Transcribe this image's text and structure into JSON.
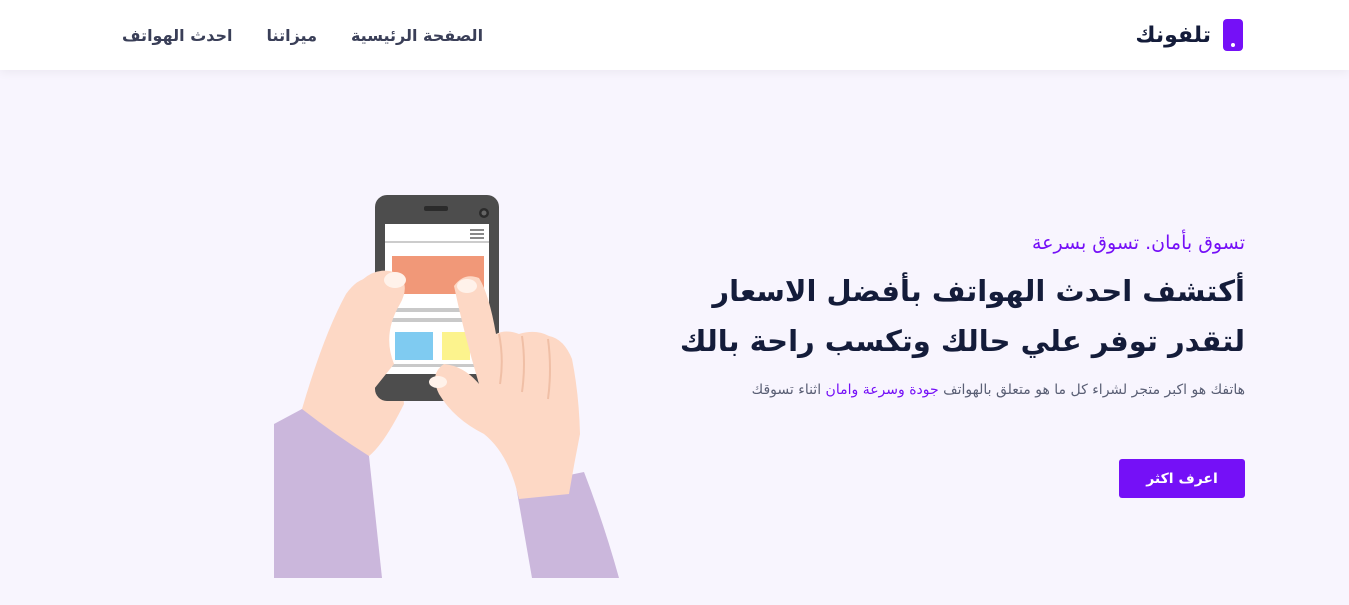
{
  "header": {
    "brand": "تلفونك",
    "nav": [
      "الصفحة الرئيسية",
      "ميزاتنا",
      "احدث الهواتف"
    ]
  },
  "hero": {
    "tagline": "تسوق بأمان. تسوق بسرعة",
    "headline_line1": "أكتشف احدث الهواتف بأفضل الاسعار",
    "headline_line2": "لتقدر توفر علي حالك وتكسب راحة بالك",
    "desc_before": "هاتفك هو اكبر متجر لشراء كل ما هو متعلق بالهواتف ",
    "desc_highlight": "جودة وسرعة وامان",
    "desc_after": " اثناء تسوقك",
    "cta": "اعرف اكثر"
  },
  "colors": {
    "accent": "#7510f7",
    "background": "#f8f5fe",
    "heading": "#141c3a"
  },
  "icons": {
    "brand": "phone-icon",
    "hero": "hands-holding-phone-illustration"
  }
}
